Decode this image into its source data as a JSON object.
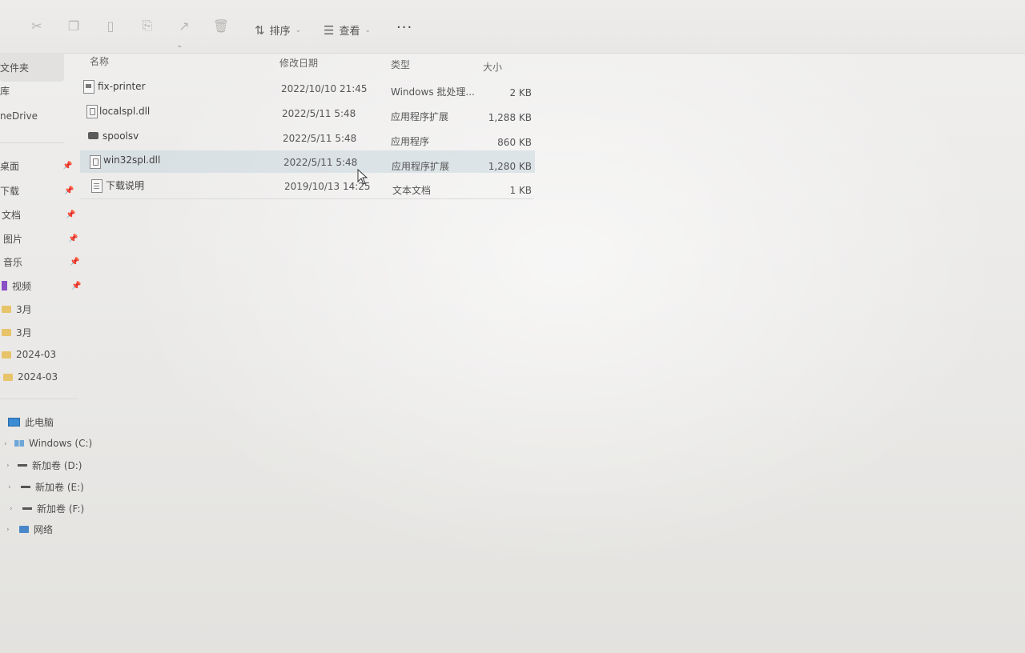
{
  "toolbar": {
    "icons": [
      "cut-icon",
      "copy-icon",
      "paste-icon",
      "rename-icon",
      "share-icon",
      "delete-icon"
    ],
    "sort_label": "排序",
    "view_label": "查看",
    "more_label": "···"
  },
  "sidebar": {
    "items": [
      {
        "label": "文件夹",
        "icon": "folder",
        "selected": true
      },
      {
        "label": "库",
        "icon": "library"
      },
      {
        "label": "neDrive",
        "icon": "cloud"
      },
      {
        "label": "桌面",
        "icon": "desktop",
        "pinned": true
      },
      {
        "label": "下载",
        "icon": "download",
        "pinned": true
      },
      {
        "label": "文档",
        "icon": "document",
        "pinned": true
      },
      {
        "label": "图片",
        "icon": "pictures",
        "pinned": true
      },
      {
        "label": "音乐",
        "icon": "music",
        "pinned": true
      },
      {
        "label": "视频",
        "icon": "video",
        "pinned": true
      },
      {
        "label": "3月",
        "icon": "folder"
      },
      {
        "label": "3月",
        "icon": "folder"
      },
      {
        "label": "2024-03",
        "icon": "folder"
      },
      {
        "label": "2024-03",
        "icon": "folder"
      }
    ],
    "this_pc": "此电脑",
    "drives": [
      {
        "label": "Windows (C:)",
        "icon": "windows-drive"
      },
      {
        "label": "新加卷 (D:)",
        "icon": "drive"
      },
      {
        "label": "新加卷 (E:)",
        "icon": "drive"
      },
      {
        "label": "新加卷 (F:)",
        "icon": "drive"
      }
    ],
    "network": "网络"
  },
  "columns": {
    "name": "名称",
    "date": "修改日期",
    "type": "类型",
    "size": "大小"
  },
  "files": [
    {
      "name": "fix-printer",
      "date": "2022/10/10 21:45",
      "type": "Windows 批处理...",
      "size": "2 KB",
      "icon": "batch-file"
    },
    {
      "name": "localspl.dll",
      "date": "2022/5/11 5:48",
      "type": "应用程序扩展",
      "size": "1,288 KB",
      "icon": "dll-file"
    },
    {
      "name": "spoolsv",
      "date": "2022/5/11 5:48",
      "type": "应用程序",
      "size": "860 KB",
      "icon": "exe-file"
    },
    {
      "name": "win32spl.dll",
      "date": "2022/5/11 5:48",
      "type": "应用程序扩展",
      "size": "1,280 KB",
      "icon": "dll-file",
      "selected": true
    },
    {
      "name": "下载说明",
      "date": "2019/10/13 14:25",
      "type": "文本文档",
      "size": "1 KB",
      "icon": "text-file"
    }
  ]
}
